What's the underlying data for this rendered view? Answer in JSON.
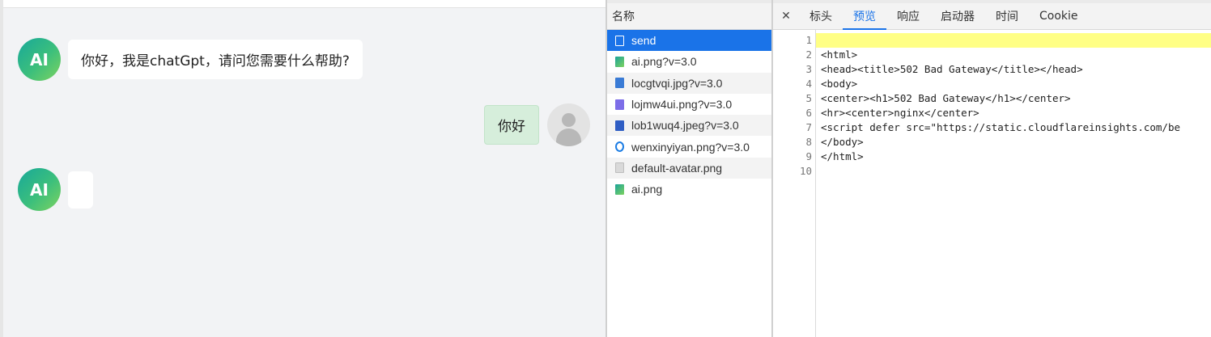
{
  "chat": {
    "ai_avatar_label": "AI",
    "ai_greeting": "你好，我是chatGpt，请问您需要什么帮助?",
    "user_message": "你好",
    "ai_reply": ""
  },
  "devtools": {
    "names_header": "名称",
    "requests": [
      {
        "name": "send",
        "icon": "document-icon"
      },
      {
        "name": "ai.png?v=3.0",
        "icon": "image-icon"
      },
      {
        "name": "locgtvqi.jpg?v=3.0",
        "icon": "image-icon"
      },
      {
        "name": "lojmw4ui.png?v=3.0",
        "icon": "image-icon"
      },
      {
        "name": "lob1wuq4.jpeg?v=3.0",
        "icon": "image-icon"
      },
      {
        "name": "wenxinyiyan.png?v=3.0",
        "icon": "image-icon"
      },
      {
        "name": "default-avatar.png",
        "icon": "image-icon"
      },
      {
        "name": "ai.png",
        "icon": "image-icon"
      }
    ],
    "close_glyph": "✕",
    "tabs": [
      "标头",
      "预览",
      "响应",
      "启动器",
      "时间",
      "Cookie"
    ],
    "active_tab": "预览",
    "code_lines": [
      {
        "n": "1",
        "text": ""
      },
      {
        "n": "2",
        "text": "<html>"
      },
      {
        "n": "3",
        "text": "<head><title>502 Bad Gateway</title></head>"
      },
      {
        "n": "4",
        "text": "<body>"
      },
      {
        "n": "5",
        "text": "<center><h1>502 Bad Gateway</h1></center>"
      },
      {
        "n": "6",
        "text": "<hr><center>nginx</center>"
      },
      {
        "n": "7",
        "text": "<script defer src=\"https://static.cloudflareinsights.com/be"
      },
      {
        "n": "8",
        "text": "</body>"
      },
      {
        "n": "9",
        "text": "</html>"
      },
      {
        "n": "10",
        "text": ""
      }
    ],
    "selection_color": "#1a73e8",
    "highlight_color": "#ffff85"
  }
}
